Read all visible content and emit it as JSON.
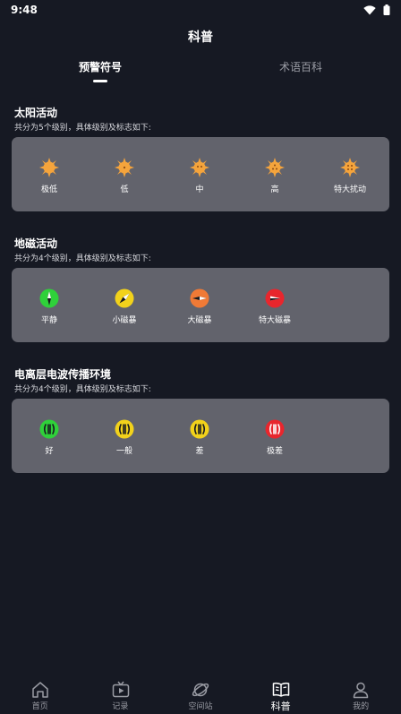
{
  "status_bar": {
    "time": "9:48"
  },
  "header": {
    "title": "科普"
  },
  "tabs": [
    {
      "label": "预警符号",
      "active": true
    },
    {
      "label": "术语百科",
      "active": false
    }
  ],
  "sections": [
    {
      "title": "太阳活动",
      "subtitle": "共分为5个级别，具体级别及标志如下:",
      "levels": [
        {
          "label": "极低",
          "icon": "sun-very-low-icon"
        },
        {
          "label": "低",
          "icon": "sun-low-icon"
        },
        {
          "label": "中",
          "icon": "sun-medium-icon"
        },
        {
          "label": "高",
          "icon": "sun-high-icon"
        },
        {
          "label": "特大扰动",
          "icon": "sun-extreme-icon"
        }
      ]
    },
    {
      "title": "地磁活动",
      "subtitle": "共分为4个级别，具体级别及标志如下:",
      "levels": [
        {
          "label": "平静",
          "icon": "compass-green-icon",
          "color": "#2fd13a"
        },
        {
          "label": "小磁暴",
          "icon": "compass-yellow-icon",
          "color": "#f2d21b"
        },
        {
          "label": "大磁暴",
          "icon": "compass-orange-icon",
          "color": "#f07a36"
        },
        {
          "label": "特大磁暴",
          "icon": "compass-red-icon",
          "color": "#e8262d"
        }
      ]
    },
    {
      "title": "电离层电波传播环境",
      "subtitle": "共分为4个级别，具体级别及标志如下:",
      "levels": [
        {
          "label": "好",
          "icon": "signal-green-icon",
          "color": "#2fd13a"
        },
        {
          "label": "一般",
          "icon": "signal-yellow-icon",
          "color": "#f2d21b"
        },
        {
          "label": "差",
          "icon": "signal-yellow-icon",
          "color": "#f2d21b"
        },
        {
          "label": "极差",
          "icon": "signal-red-icon",
          "color": "#e8262d"
        }
      ]
    }
  ],
  "bottom_nav": [
    {
      "label": "首页",
      "icon": "home-icon",
      "active": false
    },
    {
      "label": "记录",
      "icon": "tv-icon",
      "active": false
    },
    {
      "label": "空间站",
      "icon": "planet-icon",
      "active": false
    },
    {
      "label": "科普",
      "icon": "book-icon",
      "active": true
    },
    {
      "label": "我的",
      "icon": "user-icon",
      "active": false
    }
  ],
  "colors": {
    "background": "#161923",
    "card": "#62636c",
    "sun": "#f5a43c",
    "inactive_text": "#9a9ca4"
  }
}
